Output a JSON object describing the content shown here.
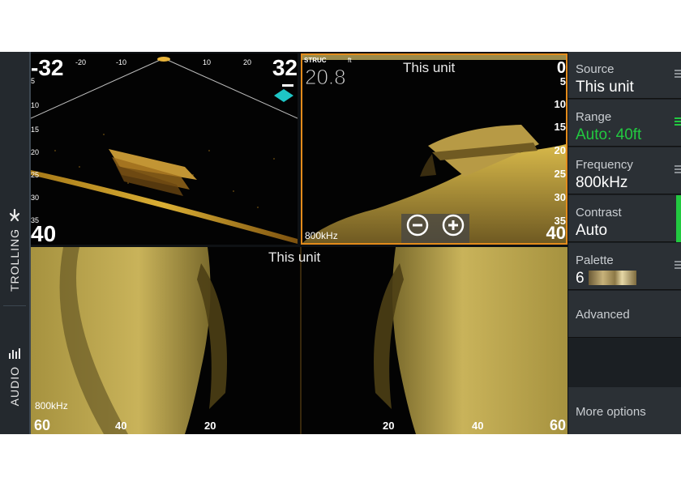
{
  "side_tabs": {
    "trolling": "TROLLING",
    "audio": "AUDIO"
  },
  "sideview": {
    "left_range": "-32",
    "right_range": "32",
    "top_ticks": [
      "-20",
      "-10",
      "10",
      "20"
    ],
    "depth_ticks": [
      "5",
      "10",
      "15",
      "20",
      "25",
      "30",
      "35"
    ],
    "bottom_depth": "40"
  },
  "downscan": {
    "source_label": "STRUC",
    "source_unit": "ft",
    "depth_reading": "20.8",
    "title": "This unit",
    "top_depth": "0",
    "depth_ticks": [
      "5",
      "10",
      "15",
      "20",
      "25",
      "30",
      "35"
    ],
    "bottom_depth": "40",
    "frequency": "800kHz"
  },
  "structure": {
    "title": "This unit",
    "frequency": "800kHz",
    "left_range": "60",
    "right_range": "60",
    "left_ticks": [
      "40",
      "20"
    ],
    "right_ticks": [
      "20",
      "40"
    ]
  },
  "menu": {
    "source": {
      "label": "Source",
      "value": "This unit"
    },
    "range": {
      "label": "Range",
      "value": "Auto: 40ft"
    },
    "frequency": {
      "label": "Frequency",
      "value": "800kHz"
    },
    "contrast": {
      "label": "Contrast",
      "value": "Auto"
    },
    "palette": {
      "label": "Palette",
      "value": "6"
    },
    "advanced": "Advanced",
    "more_options": "More options"
  },
  "colors": {
    "accent_active": "#e38b1b",
    "menu_highlight": "#22c940",
    "sonar_gold": "#d8b94a"
  },
  "icons": {
    "trolling": "trolling-motor-icon",
    "audio": "audio-bars-icon",
    "zoom_out": "minus-circle-icon",
    "zoom_in": "plus-circle-icon",
    "transducer": "transducer-cone-icon"
  }
}
